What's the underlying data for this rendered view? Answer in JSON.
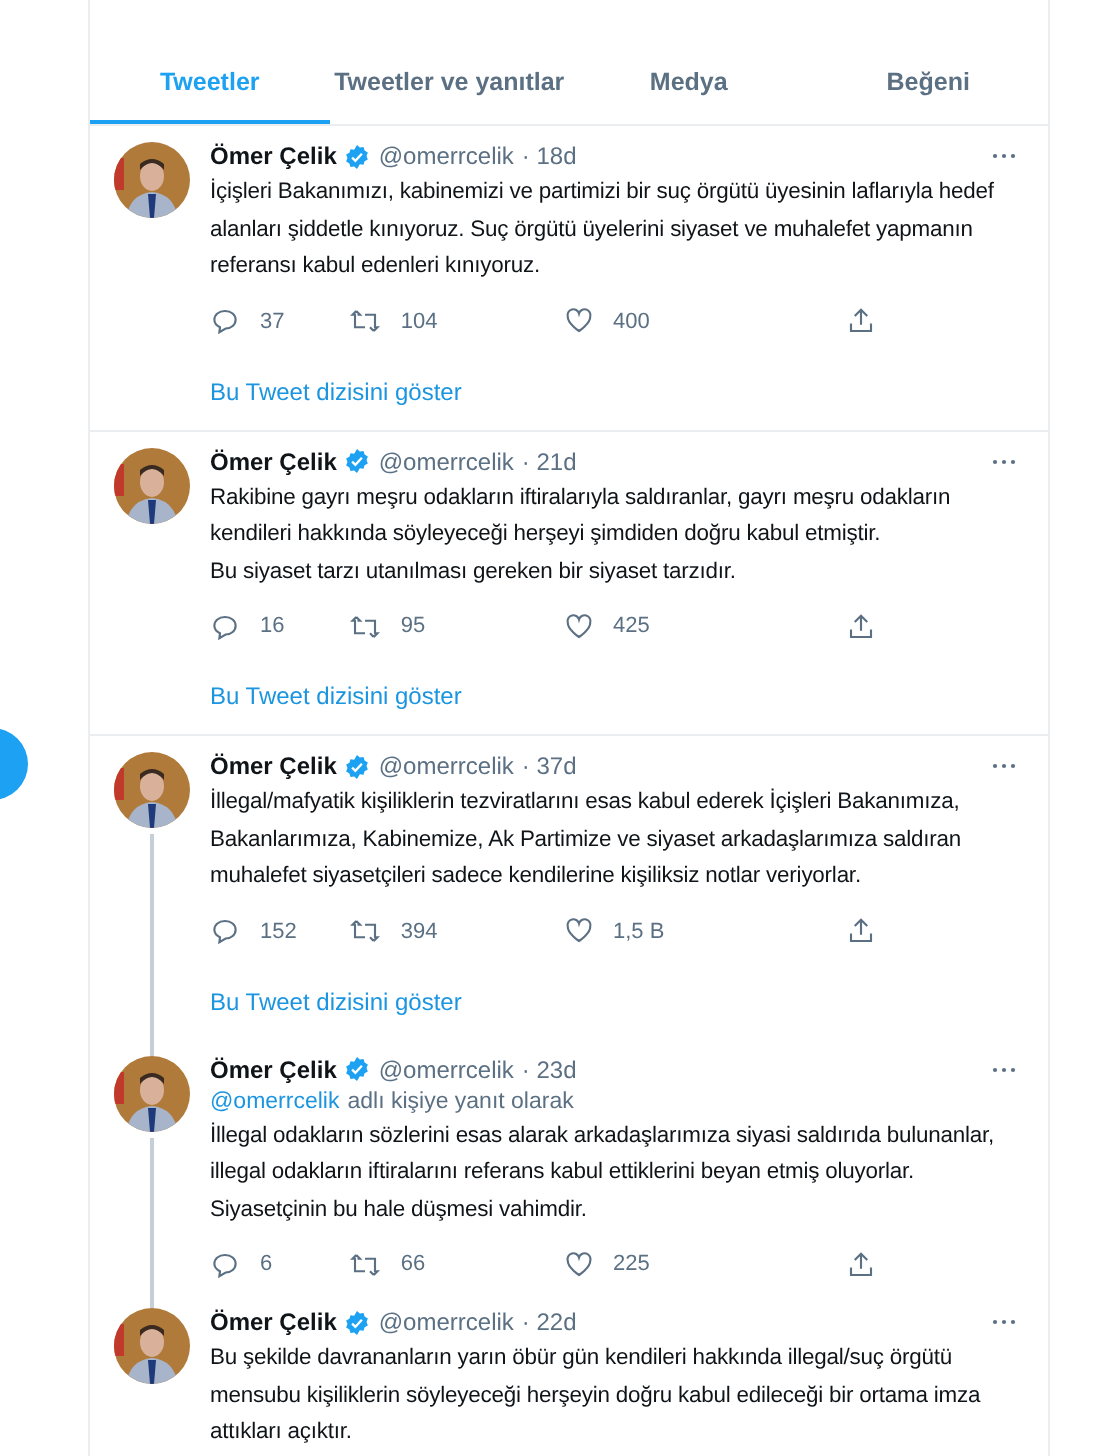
{
  "tabs": [
    {
      "label": "Tweetler",
      "selected": true
    },
    {
      "label": "Tweetler ve yanıtlar",
      "selected": false
    },
    {
      "label": "Medya",
      "selected": false
    },
    {
      "label": "Beğeni",
      "selected": false
    }
  ],
  "tweets": [
    {
      "name": "Ömer Çelik",
      "handle": "@omerrcelik",
      "time": "· 18d",
      "text": "İçişleri Bakanımızı, kabinemizi ve partimizi bir suç örgütü üyesinin laflarıyla hedef alanları şiddetle  kınıyoruz. Suç örgütü üyelerini siyaset ve muhalefet yapmanın referansı kabul edenleri kınıyoruz.",
      "replies": "37",
      "retweets": "104",
      "likes": "400",
      "show_thread": "Bu Tweet dizisini göster",
      "line_below": false,
      "line_above": false
    },
    {
      "name": "Ömer Çelik",
      "handle": "@omerrcelik",
      "time": "· 21d",
      "text": "Rakibine gayrı meşru odakların iftiralarıyla saldıranlar, gayrı meşru odakların kendileri hakkında söyleyeceği herşeyi şimdiden doğru kabul etmiştir.\nBu siyaset  tarzı utanılması gereken bir siyaset tarzıdır.",
      "replies": "16",
      "retweets": "95",
      "likes": "425",
      "show_thread": "Bu Tweet dizisini göster",
      "line_below": false,
      "line_above": false
    },
    {
      "name": "Ömer Çelik",
      "handle": "@omerrcelik",
      "time": "· 37d",
      "text": "İllegal/mafyatik kişiliklerin tezviratlarını esas kabul ederek İçişleri Bakanımıza, Bakanlarımıza, Kabinemize, Ak Partimize ve siyaset arkadaşlarımıza saldıran muhalefet siyasetçileri sadece kendilerine kişiliksiz notlar veriyorlar.",
      "replies": "152",
      "retweets": "394",
      "likes": "1,5 B",
      "show_thread": "Bu Tweet dizisini göster",
      "line_below": true,
      "line_above": false
    },
    {
      "name": "Ömer Çelik",
      "handle": "@omerrcelik",
      "time": "· 23d",
      "reply_to": "@omerrcelik",
      "reply_suffix": "adlı kişiye yanıt olarak",
      "text": "İllegal odakların sözlerini esas alarak arkadaşlarımıza siyasi saldırıda bulunanlar, illegal odakların iftiralarını referans kabul ettiklerini beyan etmiş oluyorlar. Siyasetçinin bu hale düşmesi vahimdir.",
      "replies": "6",
      "retweets": "66",
      "likes": "225",
      "line_below": true,
      "line_above": true
    },
    {
      "name": "Ömer Çelik",
      "handle": "@omerrcelik",
      "time": "· 22d",
      "text": "Bu şekilde davrananların yarın öbür gün kendileri hakkında illegal/suç örgütü mensubu kişiliklerin söyleyeceği herşeyin doğru kabul edileceği bir ortama imza attıkları açıktır.",
      "line_below": false,
      "line_above": true
    }
  ]
}
